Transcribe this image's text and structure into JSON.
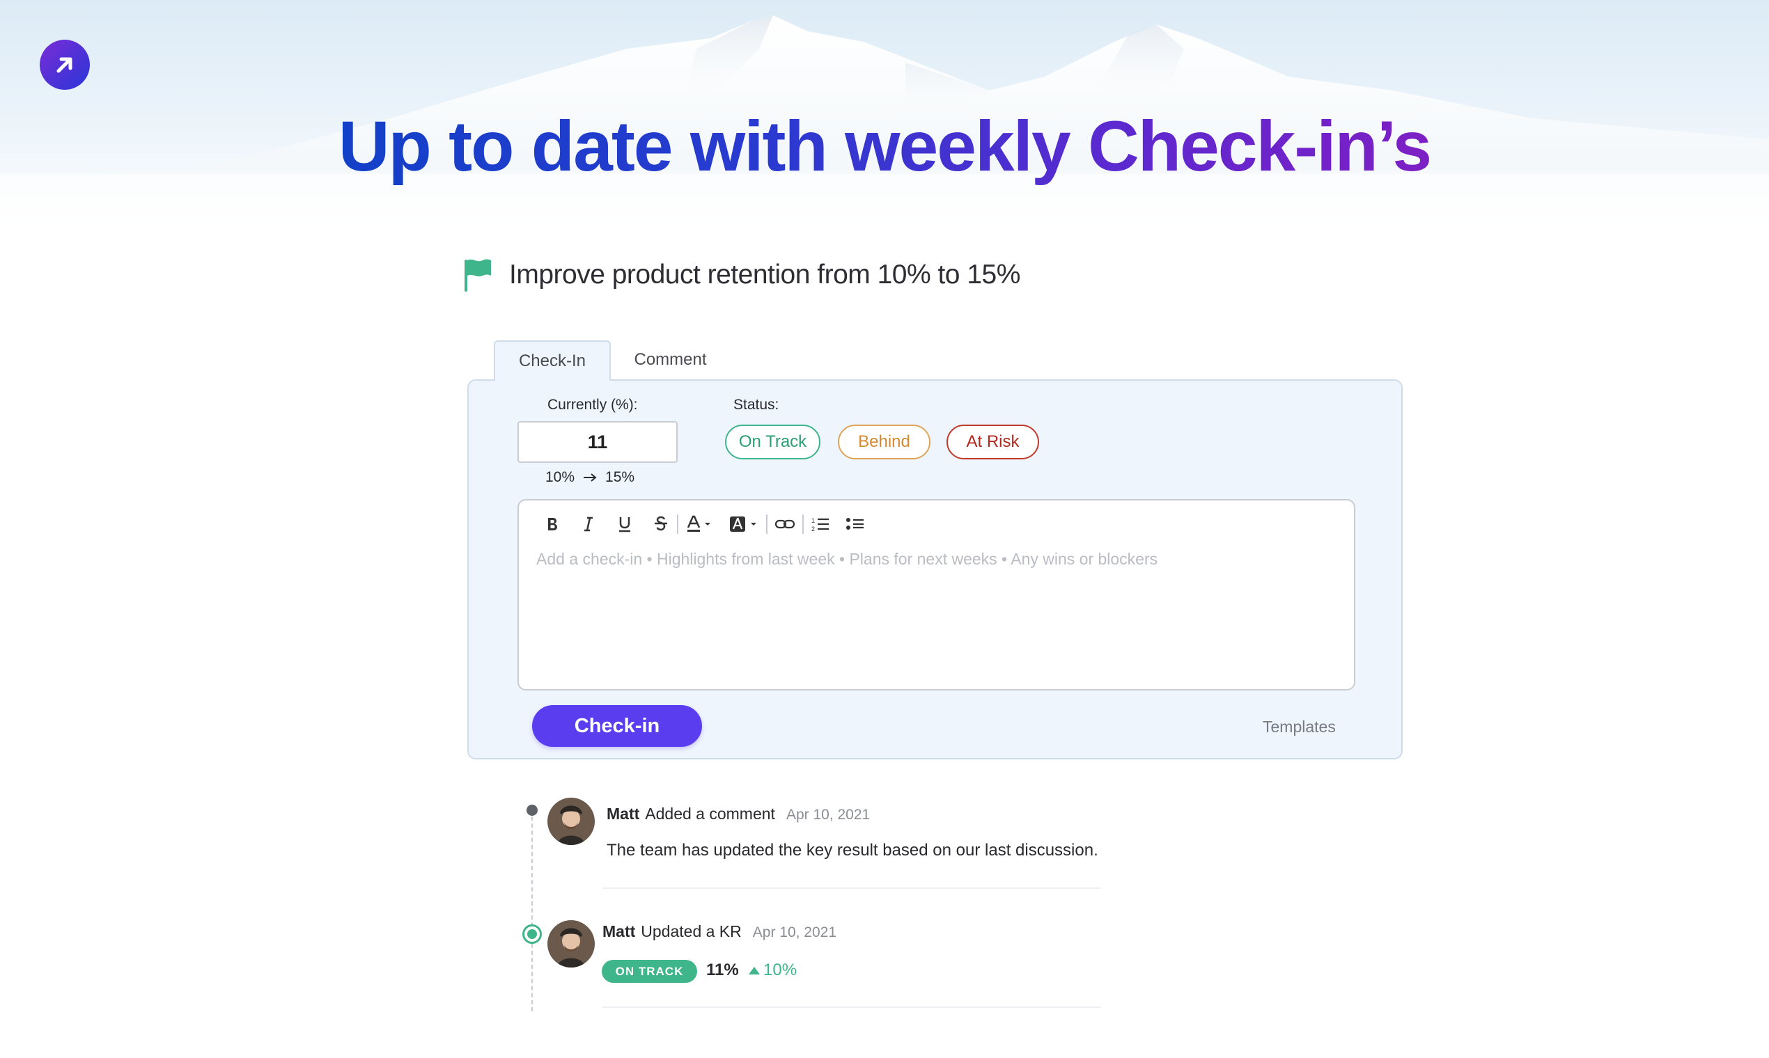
{
  "headline": "Up to date with weekly Check-in’s",
  "objective": {
    "title": "Improve product retention from 10% to 15%",
    "icon": "flag-icon",
    "icon_color": "#3eb58a"
  },
  "tabs": [
    {
      "label": "Check-In",
      "active": true
    },
    {
      "label": "Comment",
      "active": false
    }
  ],
  "checkin_form": {
    "current_label": "Currently (%):",
    "current_value": "11",
    "range_from": "10%",
    "range_to": "15%",
    "status_label": "Status:",
    "status_options": [
      {
        "label": "On Track",
        "color": "#2a9f73"
      },
      {
        "label": "Behind",
        "color": "#d48a32"
      },
      {
        "label": "At Risk",
        "color": "#b3291d"
      }
    ],
    "editor_placeholder": "Add a check-in • Highlights from last week • Plans for next weeks • Any wins or blockers",
    "toolbar": [
      "bold-icon",
      "italic-icon",
      "underline-icon",
      "strikethrough-icon",
      "text-color-icon",
      "highlight-icon",
      "link-icon",
      "ordered-list-icon",
      "bullet-list-icon"
    ],
    "submit_label": "Check-in",
    "templates_label": "Templates",
    "accent": "#5b3df0"
  },
  "timeline": [
    {
      "user": "Matt",
      "action": "Added a comment",
      "date": "Apr 10, 2021",
      "body": "The team has updated the key result based on our last discussion."
    },
    {
      "user": "Matt",
      "action": "Updated a KR",
      "date": "Apr 10, 2021",
      "status_badge": "ON TRACK",
      "value": "11%",
      "change": "10%"
    }
  ]
}
